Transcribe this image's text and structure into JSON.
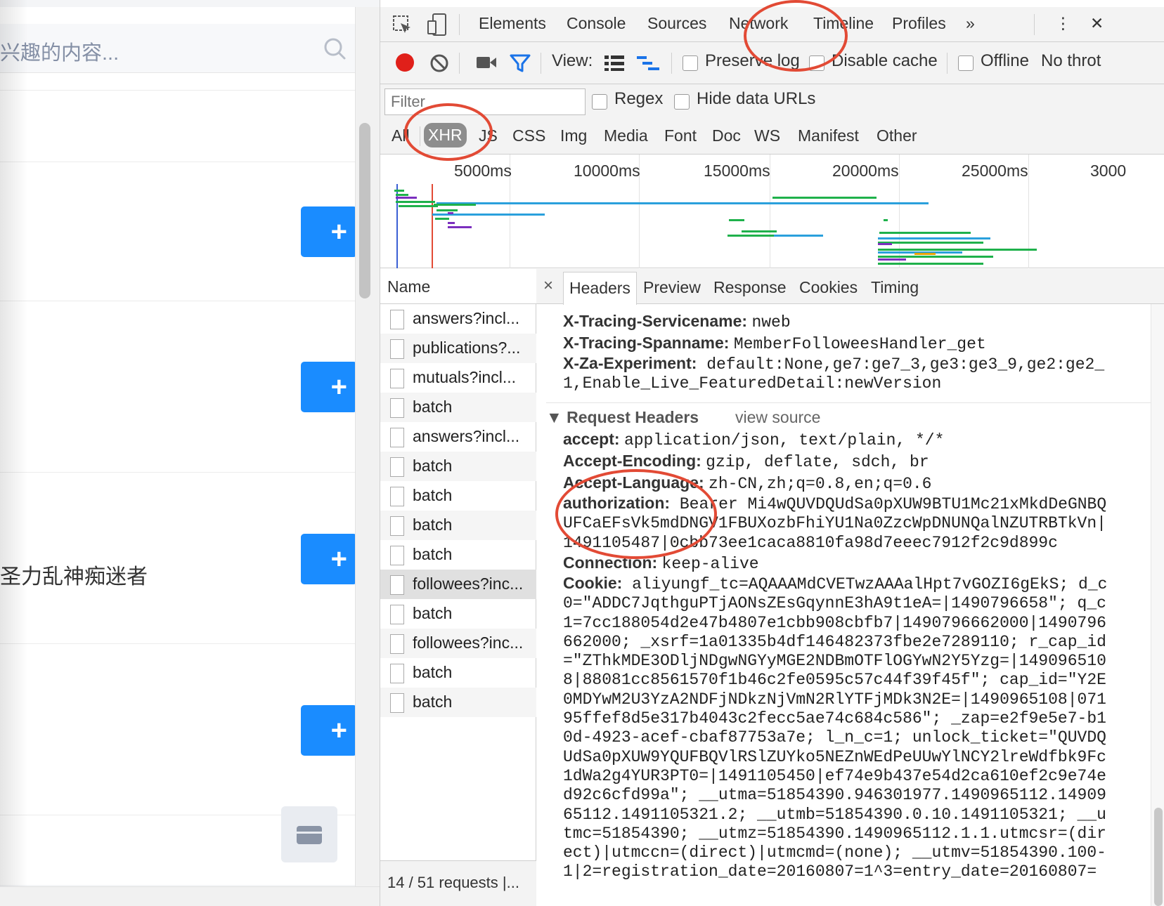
{
  "left_page": {
    "search_placeholder": "兴趣的内容...",
    "visible_user_name": "圣力乱神痴迷者",
    "follow_label": "+"
  },
  "devtools": {
    "tabs": [
      "Elements",
      "Console",
      "Sources",
      "Network",
      "Timeline",
      "Profiles"
    ],
    "active_tab": "Network",
    "more_tabs": "»",
    "menu": "⋮",
    "close": "✕",
    "toolbar": {
      "view_label": "View:",
      "preserve_log": "Preserve log",
      "disable_cache": "Disable cache",
      "offline": "Offline",
      "throttling": "No throt"
    },
    "filter": {
      "placeholder": "Filter",
      "regex": "Regex",
      "hide_data_urls": "Hide data URLs",
      "types": [
        "All",
        "XHR",
        "JS",
        "CSS",
        "Img",
        "Media",
        "Font",
        "Doc",
        "WS",
        "Manifest",
        "Other"
      ],
      "active_type": "XHR"
    },
    "timeline_ticks": [
      "5000ms",
      "10000ms",
      "15000ms",
      "20000ms",
      "25000ms",
      "3000"
    ],
    "requests": {
      "column_name": "Name",
      "rows": [
        "answers?incl...",
        "publications?...",
        "mutuals?incl...",
        "batch",
        "answers?incl...",
        "batch",
        "batch",
        "batch",
        "batch",
        "followees?inc...",
        "batch",
        "followees?inc...",
        "batch",
        "batch"
      ],
      "selected_index": 9,
      "status": "14 / 51 requests |..."
    },
    "detail": {
      "close": "×",
      "tabs": [
        "Headers",
        "Preview",
        "Response",
        "Cookies",
        "Timing"
      ],
      "active_tab": "Headers",
      "response_headers": [
        {
          "name": "X-Tracing-Servicename:",
          "value": "nweb"
        },
        {
          "name": "X-Tracing-Spanname:",
          "value": "MemberFolloweesHandler_get"
        },
        {
          "name": "X-Za-Experiment:",
          "value": "default:None,ge7:ge7_3,ge3:ge3_9,ge2:ge2_1,Enable_Live_FeaturedDetail:newVersion"
        }
      ],
      "request_headers_title": "Request Headers",
      "view_source": "view source",
      "request_headers": [
        {
          "name": "accept:",
          "value": "application/json, text/plain, */*"
        },
        {
          "name": "Accept-Encoding:",
          "value": "gzip, deflate, sdch, br"
        },
        {
          "name": "Accept-Language:",
          "value": "zh-CN,zh;q=0.8,en;q=0.6"
        },
        {
          "name": "authorization:",
          "value": "Bearer Mi4wQUVDQUdSa0pXUW9BTU1Mc21xMkdDeGNBQUFCaEFsVk5mdDNGV1FBUXozbFhiYU1Na0ZzcWpDNUNQalNZUTRBTkVn|1491105487|0cbb73ee1caca8810fa98d7eeec7912f2c9d899c"
        },
        {
          "name": "Connection:",
          "value": "keep-alive"
        },
        {
          "name": "Cookie:",
          "value": "aliyungf_tc=AQAAAMdCVETwzAAAalHpt7vGOZI6gEkS; d_c0=\"ADDC7JqthguPTjAONsZEsGqynnE3hA9t1eA=|1490796658\"; q_c1=7cc188054d2e47b4807e1cbb908cbfb7|1490796662000|1490796662000; _xsrf=1a01335b4df146482373fbe2e7289110; r_cap_id=\"ZThkMDE3ODljNDgwNGYyMGE2NDBmOTFlOGYwN2Y5Yzg=|1490965108|88081cc8561570f1b46c2fe0595c57c44f39f45f\"; cap_id=\"Y2E0MDYwM2U3YzA2NDFjNDkzNjVmN2RlYTFjMDk3N2E=|1490965108|07195ffef8d5e317b4043c2fecc5ae74c684c586\"; _zap=e2f9e5e7-b10d-4923-acef-cbaf87753a7e; l_n_c=1; unlock_ticket=\"QUVDQUdSa0pXUW9YQUFBQVlRSlZUYko5NEZnWEdPeUUwYlNCY2lreWdfbk9Fc1dWa2g4YUR3PT0=|1491105450|ef74e9b437e54d2ca610ef2c9e74ed92c6cfd99a\"; __utma=51854390.946301977.1490965112.1490965112.1491105321.2; __utmb=51854390.0.10.1491105321; __utmc=51854390; __utmz=51854390.1490965112.1.1.utmcsr=(direct)|utmccn=(direct)|utmcmd=(none); __utmv=51854390.100-1|2=registration_date=20160807=1^3=entry_date=20160807="
        }
      ]
    }
  },
  "colors": {
    "annotation": "#e24a35",
    "follow_button": "#1a8cff",
    "record": "#e0201a",
    "filter_icon": "#1a73e8"
  }
}
